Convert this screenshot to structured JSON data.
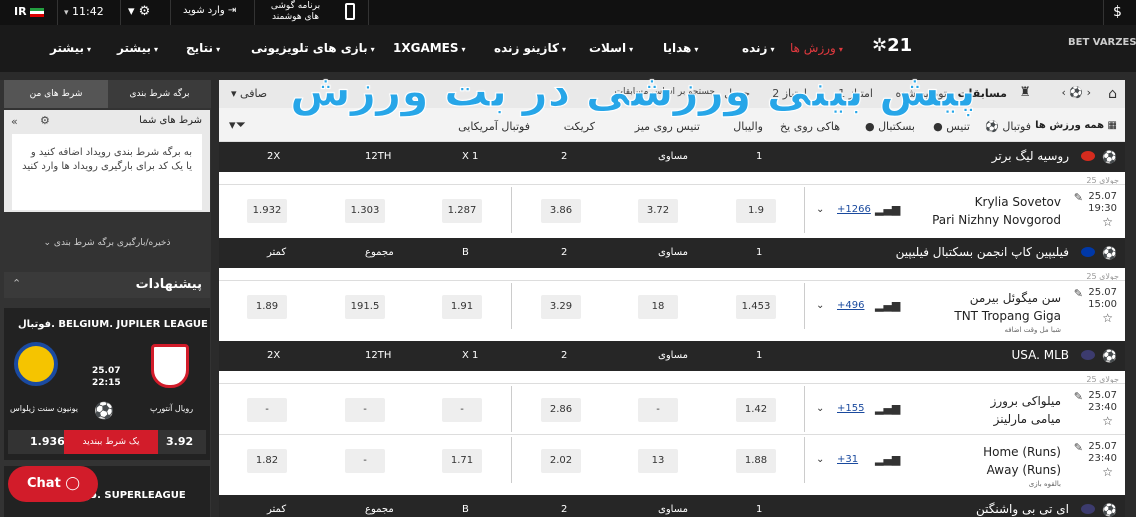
{
  "topbar": {
    "lang": "IR",
    "time": "11:42",
    "login": "وارد شوید",
    "mobile_app": "برنامه گوشی های هوشمند",
    "dollar": "$"
  },
  "logo": {
    "brand": "BET VARZESH",
    "partner": "21"
  },
  "nav": {
    "items": [
      "ورزش ها",
      "زنده",
      "هدایا",
      "اسلات",
      "کازینو زنده",
      "1XGAMES",
      "بازی های تلویزیونی",
      "نتایج",
      "بیشتر",
      "بیشتر"
    ]
  },
  "left": {
    "tab_coupon": "برگه شرط بندی",
    "tab_mybets": "شرط های من",
    "your_bets": "شرط های شما",
    "empty_msg": "به برگه شرط بندی رویداد اضافه کنید و یا یک کد برای بارگیری رویداد ها وارد کنید",
    "save_load": "ذخیره/بارگیری برگه شرط بندی",
    "offers": "پیشنهادات",
    "promo": {
      "league": "فوتبال. BELGIUM. JUPILER LEAGUE",
      "date": "25.07",
      "time": "22:15",
      "team1": "رویال آنتورپ",
      "team2": "یونیون سنت ژیلواس",
      "odd1": "3.92",
      "odd2": "1.936",
      "bet_btn": "یک شرط ببندید"
    },
    "promo2_league": "فوتبال. SUPERLEAGUE",
    "chat": "Chat"
  },
  "main": {
    "toolbar": {
      "competitions": "مسابقات",
      "recommended": "توصیه شده",
      "s1": "1 امتیاز",
      "s2": "2 امتیاز",
      "table": "جدول",
      "search": "جستجو بر اساس مسابقات",
      "filter": "صافی"
    },
    "sports": [
      "همه ورزش ها",
      "فوتبال",
      "تنیس",
      "بسکتبال",
      "هاکی روی یخ",
      "والیبال",
      "تنیس روی میز",
      "کریکت",
      "فوتبال آمریکایی"
    ],
    "overlay": "پیش بینی ورزشی در بت ورزش",
    "leagues": [
      {
        "name": "روسیه لیگ برتر",
        "cols": [
          "1",
          "مساوی",
          "2",
          "X 1",
          "12TH",
          "2X"
        ]
      },
      {
        "name": "فیلیپین کاپ انجمن بسکتبال فیلیپین",
        "cols": [
          "1",
          "مساوی",
          "2",
          "B",
          "مجموع",
          "کمتر"
        ]
      },
      {
        "name": "USA. MLB",
        "cols": [
          "1",
          "مساوی",
          "2",
          "X 1",
          "12TH",
          "2X"
        ]
      },
      {
        "name": "ای تی بی واشنگتن",
        "cols": [
          "1",
          "مساوی",
          "2",
          "B",
          "مجموع",
          "کمتر"
        ]
      }
    ],
    "day_label": "25 جولای",
    "events": [
      {
        "date": "25.07",
        "time": "19:30",
        "team1": "Krylia Sovetov",
        "team2": "Pari Nizhny Novgorod",
        "more": "+1266",
        "odds": [
          "1.9",
          "3.72",
          "3.86",
          "1.287",
          "1.303",
          "1.932"
        ]
      },
      {
        "date": "25.07",
        "time": "15:00",
        "team1": "سن میگوئل بیرمن",
        "team2": "TNT Tropang Giga",
        "note": "شبا مل وقت اضافه",
        "more": "+496",
        "odds": [
          "1.453",
          "18",
          "3.29",
          "1.91",
          "191.5",
          "1.89"
        ]
      },
      {
        "date": "25.07",
        "time": "23:40",
        "team1": "میلواکی برورز",
        "team2": "میامی مارلینز",
        "more": "+155",
        "odds": [
          "1.42",
          "-",
          "2.86",
          "-",
          "-",
          "-"
        ]
      },
      {
        "date": "25.07",
        "time": "23:40",
        "team1": "Home (Runs)",
        "team2": "Away (Runs)",
        "note": "بالقوه بازی",
        "more": "+31",
        "odds": [
          "1.88",
          "13",
          "2.02",
          "1.71",
          "-",
          "1.82"
        ]
      }
    ]
  },
  "colors": {
    "accent": "#e0393e",
    "overlay": "#27a6e8",
    "dark": "#262626"
  }
}
